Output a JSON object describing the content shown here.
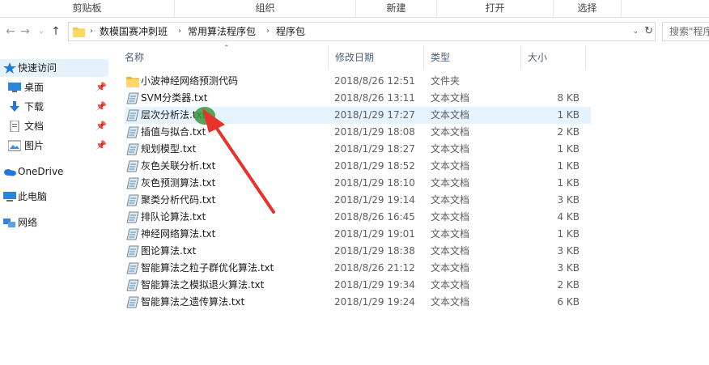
{
  "ribbon": {
    "groups": [
      "剪贴板",
      "组织",
      "新建",
      "打开",
      "选择"
    ]
  },
  "nav": {
    "back_icon": "arrow-left-icon",
    "forward_icon": "arrow-right-icon",
    "recent_icon": "chevron-down-icon",
    "up_icon": "arrow-up-icon"
  },
  "address": {
    "crumbs": [
      "数模国赛冲刺班",
      "常用算法程序包",
      "程序包"
    ],
    "separator": "›",
    "dropdown": "⌄",
    "refresh": "↻"
  },
  "search": {
    "placeholder": "搜索\"程序包\""
  },
  "sidebar": {
    "items": [
      {
        "label": "快速访问",
        "icon": "star-icon",
        "pinned": false
      },
      {
        "label": "桌面",
        "icon": "desktop-icon",
        "pinned": true
      },
      {
        "label": "下载",
        "icon": "download-icon",
        "pinned": true
      },
      {
        "label": "文档",
        "icon": "document-icon",
        "pinned": true
      },
      {
        "label": "图片",
        "icon": "picture-icon",
        "pinned": true
      },
      {
        "label": "OneDrive",
        "icon": "cloud-icon",
        "pinned": false
      },
      {
        "label": "此电脑",
        "icon": "computer-icon",
        "pinned": false
      },
      {
        "label": "网络",
        "icon": "network-icon",
        "pinned": false
      }
    ]
  },
  "columns": {
    "name": "名称",
    "modified": "修改日期",
    "type": "类型",
    "size": "大小"
  },
  "files": [
    {
      "name": "小波神经网络预测代码",
      "modified": "2018/8/26 12:51",
      "type": "文件夹",
      "size": "",
      "kind": "folder"
    },
    {
      "name": "SVM分类器.txt",
      "modified": "2018/8/26 13:11",
      "type": "文本文档",
      "size": "8 KB",
      "kind": "txt"
    },
    {
      "name": "层次分析法.txt",
      "modified": "2018/1/29 17:27",
      "type": "文本文档",
      "size": "1 KB",
      "kind": "txt"
    },
    {
      "name": "插值与拟合.txt",
      "modified": "2018/1/29 18:08",
      "type": "文本文档",
      "size": "2 KB",
      "kind": "txt"
    },
    {
      "name": "规划模型.txt",
      "modified": "2018/1/29 18:27",
      "type": "文本文档",
      "size": "1 KB",
      "kind": "txt"
    },
    {
      "name": "灰色关联分析.txt",
      "modified": "2018/1/29 18:52",
      "type": "文本文档",
      "size": "1 KB",
      "kind": "txt"
    },
    {
      "name": "灰色预测算法.txt",
      "modified": "2018/1/29 18:10",
      "type": "文本文档",
      "size": "1 KB",
      "kind": "txt"
    },
    {
      "name": "聚类分析代码.txt",
      "modified": "2018/1/29 19:14",
      "type": "文本文档",
      "size": "3 KB",
      "kind": "txt"
    },
    {
      "name": "排队论算法.txt",
      "modified": "2018/8/26 16:45",
      "type": "文本文档",
      "size": "4 KB",
      "kind": "txt"
    },
    {
      "name": "神经网络算法.txt",
      "modified": "2018/1/29 19:01",
      "type": "文本文档",
      "size": "1 KB",
      "kind": "txt"
    },
    {
      "name": "图论算法.txt",
      "modified": "2018/1/29 18:38",
      "type": "文本文档",
      "size": "3 KB",
      "kind": "txt"
    },
    {
      "name": "智能算法之粒子群优化算法.txt",
      "modified": "2018/8/26 21:12",
      "type": "文本文档",
      "size": "3 KB",
      "kind": "txt"
    },
    {
      "name": "智能算法之模拟退火算法.txt",
      "modified": "2018/1/29 19:34",
      "type": "文本文档",
      "size": "2 KB",
      "kind": "txt"
    },
    {
      "name": "智能算法之遗传算法.txt",
      "modified": "2018/1/29 19:24",
      "type": "文本文档",
      "size": "6 KB",
      "kind": "txt"
    }
  ],
  "colors": {
    "accent": "#0078d7",
    "hover_row": "#e5f3ff",
    "folder": "#f6c64a",
    "annotation_arrow": "#e8322c",
    "cursor_dot": "#3c963c"
  }
}
